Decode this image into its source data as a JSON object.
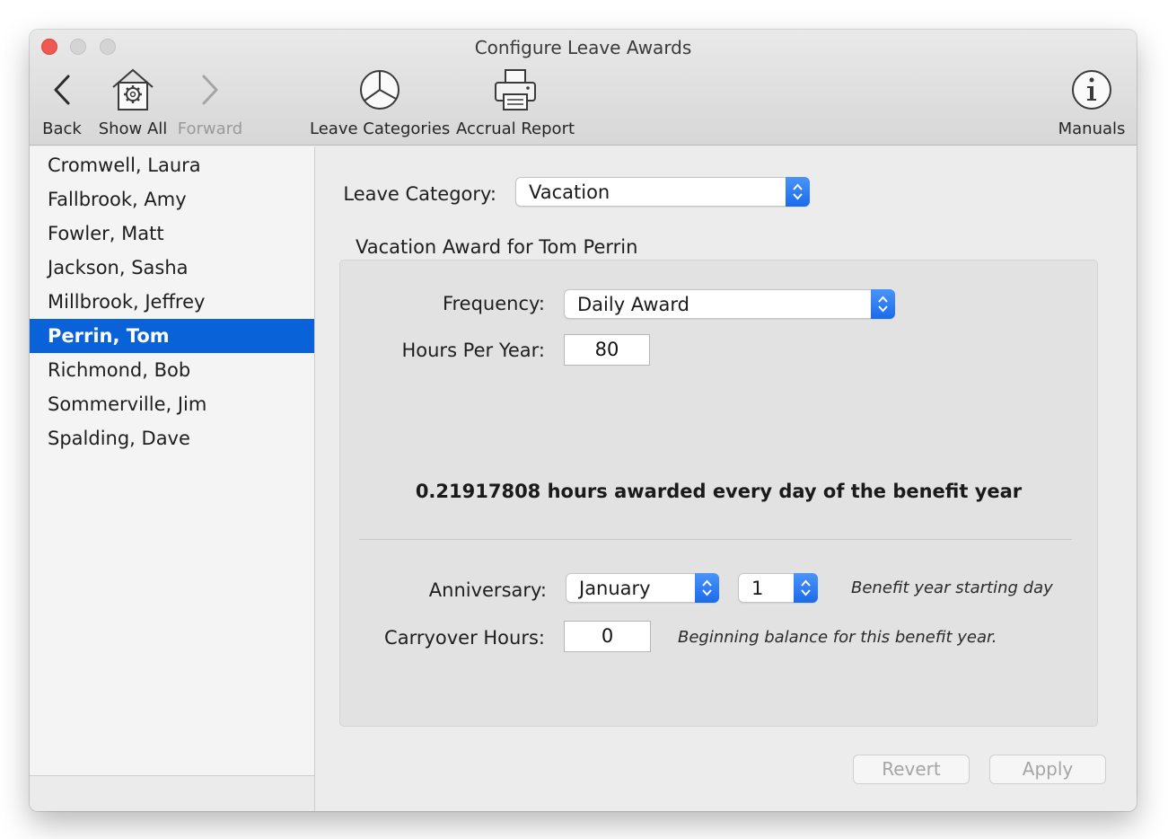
{
  "window": {
    "title": "Configure Leave Awards"
  },
  "toolbar": {
    "back_label": "Back",
    "show_all_label": "Show All",
    "forward_label": "Forward",
    "leave_categories_label": "Leave Categories",
    "accrual_report_label": "Accrual Report",
    "manuals_label": "Manuals"
  },
  "sidebar": {
    "items": [
      {
        "label": "Cromwell, Laura"
      },
      {
        "label": "Fallbrook, Amy"
      },
      {
        "label": "Fowler, Matt"
      },
      {
        "label": "Jackson, Sasha"
      },
      {
        "label": "Millbrook, Jeffrey"
      },
      {
        "label": "Perrin, Tom"
      },
      {
        "label": "Richmond, Bob"
      },
      {
        "label": "Sommerville, Jim"
      },
      {
        "label": "Spalding, Dave"
      }
    ],
    "selected_index": 5
  },
  "form": {
    "leave_category_label": "Leave Category:",
    "leave_category_value": "Vacation",
    "section_title": "Vacation Award for Tom Perrin",
    "frequency_label": "Frequency:",
    "frequency_value": "Daily Award",
    "hours_per_year_label": "Hours Per Year:",
    "hours_per_year_value": "80",
    "summary": "0.21917808 hours awarded every day of the benefit year",
    "anniversary_label": "Anniversary:",
    "anniversary_month": "January",
    "anniversary_day": "1",
    "anniversary_hint": "Benefit year starting day",
    "carryover_label": "Carryover Hours:",
    "carryover_value": "0",
    "carryover_hint": "Beginning balance for this benefit year."
  },
  "buttons": {
    "revert_label": "Revert",
    "apply_label": "Apply"
  },
  "colors": {
    "selection": "#0a62d8",
    "stepper": "#1a6bea",
    "close": "#ee5a52"
  }
}
